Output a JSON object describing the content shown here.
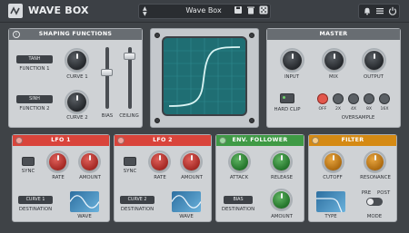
{
  "header": {
    "title": "WAVE BOX",
    "preset_name": "Wave Box",
    "icons": [
      "logo-icon",
      "preset-up-icon",
      "preset-down-icon",
      "save-icon",
      "trash-icon",
      "dice-icon",
      "bell-icon",
      "menu-icon",
      "power-icon"
    ]
  },
  "shaping": {
    "title": "SHAPING FUNCTIONS",
    "function1_type": "TANH",
    "function1_label": "FUNCTION 1",
    "function2_type": "SINH",
    "function2_label": "FUNCTION 2",
    "curve1_label": "CURVE 1",
    "curve2_label": "CURVE 2",
    "bias_label": "BIAS",
    "ceiling_label": "CEILING",
    "bias_level": 0.6,
    "ceiling_level": 0.9
  },
  "master": {
    "title": "MASTER",
    "input_label": "INPUT",
    "mix_label": "MIX",
    "output_label": "OUTPUT",
    "hard_clip_label": "HARD CLIP",
    "oversample_label": "OVERSAMPLE",
    "oversample_options": [
      "OFF",
      "2X",
      "4X",
      "8X",
      "16X"
    ],
    "oversample_selected": "OFF"
  },
  "lfo1": {
    "title": "LFO 1",
    "sync_label": "SYNC",
    "rate_label": "RATE",
    "amount_label": "AMOUNT",
    "destination_value": "CURVE 1",
    "destination_label": "DESTINATION",
    "wave_label": "WAVE",
    "accent": "#d9443b"
  },
  "lfo2": {
    "title": "LFO 2",
    "sync_label": "SYNC",
    "rate_label": "RATE",
    "amount_label": "AMOUNT",
    "destination_value": "CURVE 2",
    "destination_label": "DESTINATION",
    "wave_label": "WAVE",
    "accent": "#d9443b"
  },
  "env": {
    "title": "ENV. FOLLOWER",
    "attack_label": "ATTACK",
    "release_label": "RELEASE",
    "destination_value": "BIAS",
    "destination_label": "DESTINATION",
    "amount_label": "AMOUNT",
    "accent": "#3f9a45"
  },
  "filter": {
    "title": "FILTER",
    "cutoff_label": "CUTOFF",
    "resonance_label": "RESONANCE",
    "type_label": "TYPE",
    "mode_label": "MODE",
    "pre_label": "PRE",
    "post_label": "POST",
    "accent": "#d58a14"
  }
}
